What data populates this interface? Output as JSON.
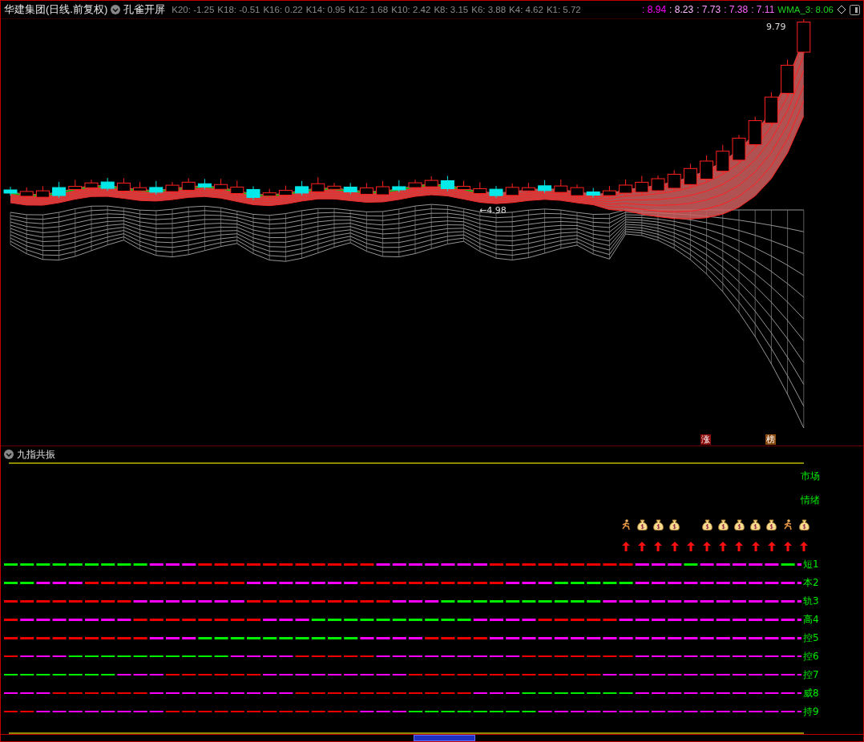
{
  "header": {
    "title": "华建集团(日线.前复权)",
    "indicator": "孔雀开屏",
    "k_values": [
      "K20: -1.25",
      "K18: -0.51",
      "K16: 0.22",
      "K14: 0.95",
      "K12: 1.68",
      "K10: 2.42",
      "K8: 3.15",
      "K6: 3.88",
      "K4: 4.62",
      "K1: 5.72"
    ],
    "ma_values": [
      {
        "text": ": 8.94",
        "color": "#ff00ff"
      },
      {
        "text": ": 8.23",
        "color": "#ffbbff"
      },
      {
        "text": ": 7.73",
        "color": "#ff99ff"
      },
      {
        "text": ": 7.38",
        "color": "#ff66ff"
      },
      {
        "text": ": 7.11",
        "color": "#ee66ee"
      }
    ],
    "wma": "WMA_3: 8.06"
  },
  "main_chart": {
    "high_label": "9.79",
    "low_label": "←4.98",
    "badges": [
      {
        "text": "涨",
        "color": "#8b0a0a"
      },
      {
        "text": "榜",
        "color": "#8b4a10"
      }
    ]
  },
  "lower_panel": {
    "title": "九指共振",
    "side_labels": [
      "市场",
      "情绪"
    ],
    "signal_columns": [
      {
        "kind": "runner"
      },
      {
        "kind": "bag"
      },
      {
        "kind": "bag"
      },
      {
        "kind": "bag"
      },
      {
        "kind": "empty"
      },
      {
        "kind": "bag"
      },
      {
        "kind": "bag"
      },
      {
        "kind": "bag"
      },
      {
        "kind": "bag"
      },
      {
        "kind": "bag"
      },
      {
        "kind": "runner"
      },
      {
        "kind": "bag"
      }
    ],
    "rows": [
      "短1",
      "本2",
      "轨3",
      "高4",
      "控5",
      "控6",
      "控7",
      "威8",
      "持9"
    ]
  }
}
